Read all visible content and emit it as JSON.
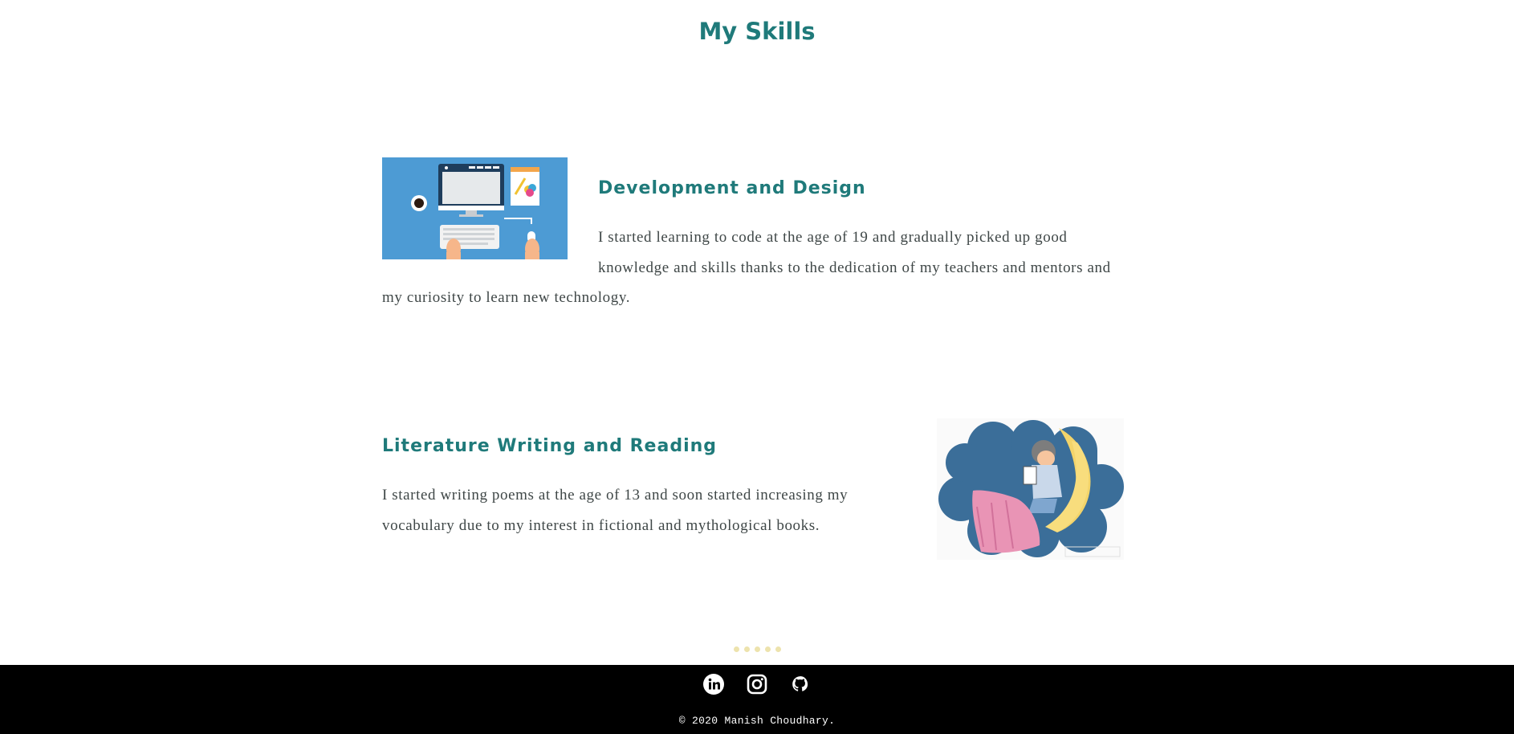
{
  "page": {
    "title": "My Skills"
  },
  "skills": [
    {
      "heading": "Development and Design",
      "text": "I started learning to code at the age of 19 and gradually picked up good knowledge and skills thanks to the dedication of my teachers and mentors and my curiosity to learn new technology.",
      "image_alt": "desk-illustration"
    },
    {
      "heading": "Literature Writing and Reading",
      "text": "I started writing poems at the age of 13 and soon started increasing my vocabulary due to my interest in fictional and mythological books.",
      "image_alt": "boy-reading-on-moon-illustration"
    }
  ],
  "footer": {
    "social": [
      {
        "name": "linkedin-icon"
      },
      {
        "name": "instagram-icon"
      },
      {
        "name": "github-icon"
      }
    ],
    "copyright": "© 2020 Manish Choudhary."
  },
  "colors": {
    "accent": "#1f7a7a",
    "text": "#3f4747",
    "footer_bg": "#000000",
    "dots": "#ede3ad",
    "illustration_blue": "#4d9bd4"
  }
}
